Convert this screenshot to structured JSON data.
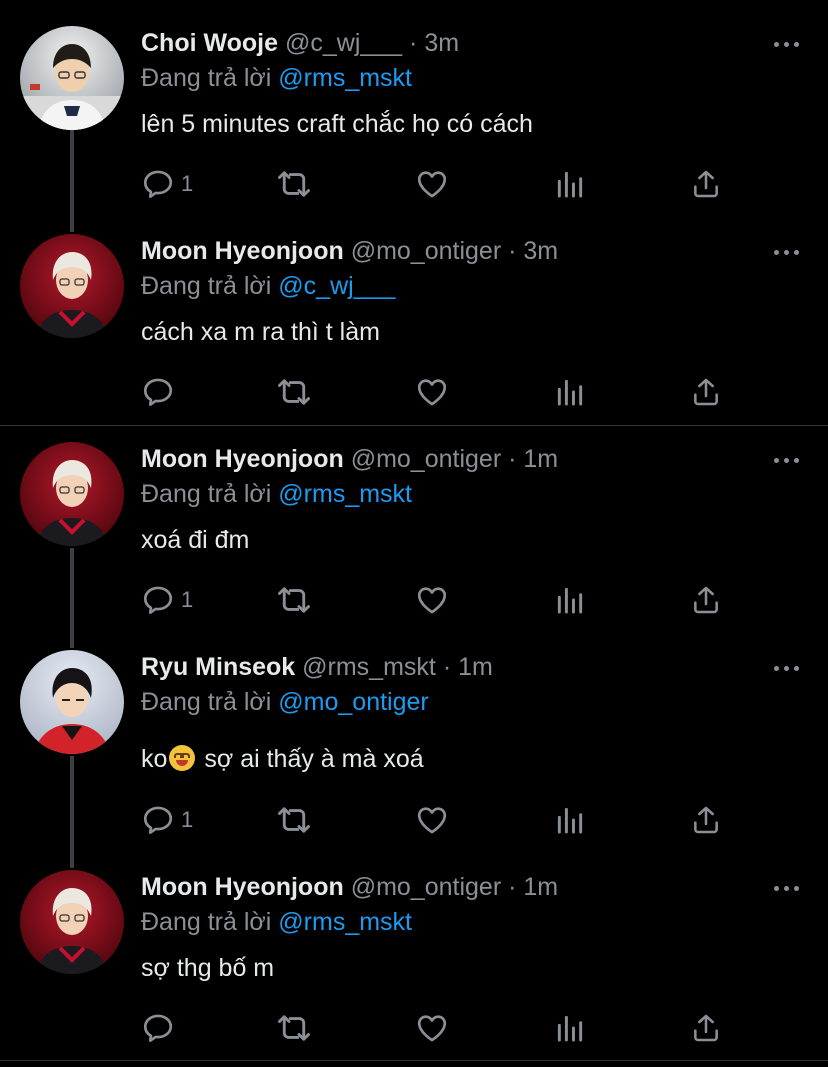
{
  "tweets": [
    {
      "name": "Choi Wooje",
      "handle": "@c_wj___",
      "dot": "·",
      "time": "3m",
      "reply_prefix": "Đang trả lời",
      "reply_to": "@rms_mskt",
      "text": "lên 5 minutes craft chắc họ có cách",
      "reply_count": "1",
      "avatar": "avatar-choi-wooje"
    },
    {
      "name": "Moon Hyeonjoon",
      "handle": "@mo_ontiger",
      "dot": "·",
      "time": "3m",
      "reply_prefix": "Đang trả lời",
      "reply_to": "@c_wj___",
      "text": "cách xa m ra thì t làm",
      "reply_count": "",
      "avatar": "avatar-moon-hyeonjoon"
    },
    {
      "name": "Moon Hyeonjoon",
      "handle": "@mo_ontiger",
      "dot": "·",
      "time": "1m",
      "reply_prefix": "Đang trả lời",
      "reply_to": "@rms_mskt",
      "text": "xoá đi đm",
      "reply_count": "1",
      "avatar": "avatar-moon-hyeonjoon"
    },
    {
      "name": "Ryu Minseok",
      "handle": "@rms_mskt",
      "dot": "·",
      "time": "1m",
      "reply_prefix": "Đang trả lời",
      "reply_to": "@mo_ontiger",
      "text_before_emoji": "ko",
      "emoji": "smiling-face-emoji",
      "text_after_emoji": " sợ ai thấy à mà xoá",
      "reply_count": "1",
      "avatar": "avatar-ryu-minseok"
    },
    {
      "name": "Moon Hyeonjoon",
      "handle": "@mo_ontiger",
      "dot": "·",
      "time": "1m",
      "reply_prefix": "Đang trả lời",
      "reply_to": "@rms_mskt",
      "text": "sợ thg bố m",
      "reply_count": "",
      "avatar": "avatar-moon-hyeonjoon"
    }
  ],
  "icons": {
    "reply": "reply-icon",
    "retweet": "retweet-icon",
    "like": "heart-icon",
    "analytics": "analytics-icon",
    "share": "share-icon",
    "more": "more-icon"
  },
  "colors": {
    "background": "#000000",
    "text": "#e7e9ea",
    "secondary": "#8b9096",
    "link": "#1d9bf0",
    "divider": "#2f3336"
  }
}
